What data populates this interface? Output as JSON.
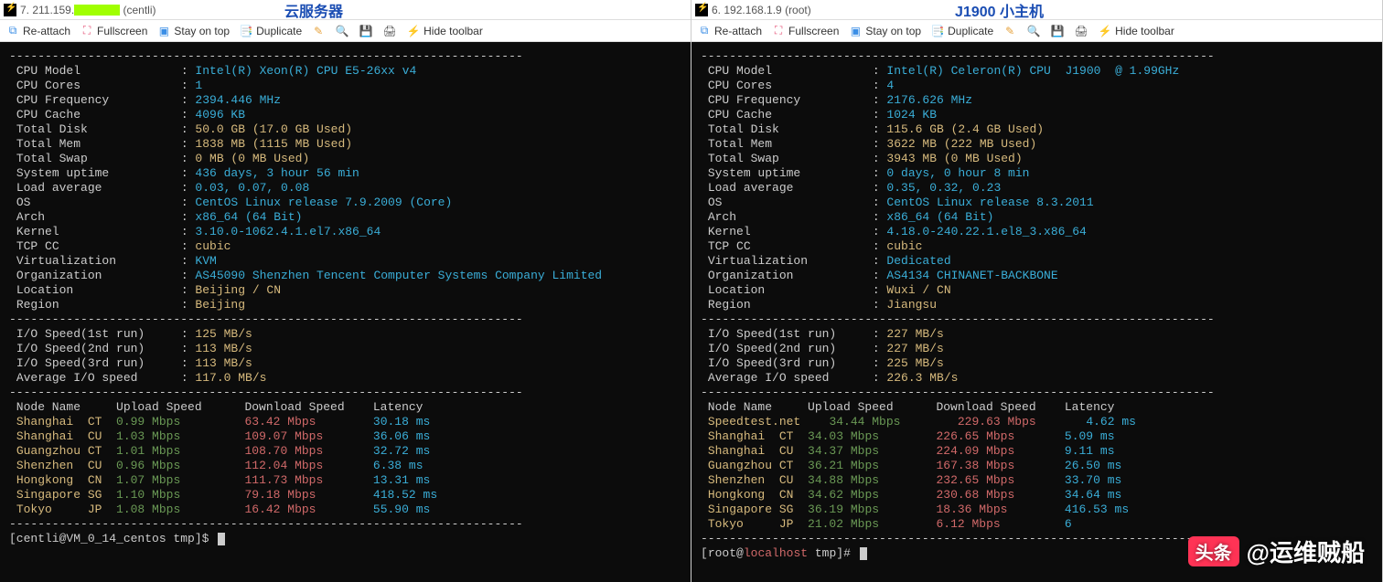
{
  "left": {
    "tab_title_prefix": "7. 211.159.",
    "tab_title_suffix": " (centli)",
    "header_label": "云服务器",
    "sysinfo": {
      "cpu_model": "Intel(R) Xeon(R) CPU E5-26xx v4",
      "cpu_cores": "1",
      "cpu_freq": "2394.446 MHz",
      "cpu_cache": "4096 KB",
      "total_disk": "50.0 GB (17.0 GB Used)",
      "total_mem": "1838 MB (1115 MB Used)",
      "total_swap": "0 MB (0 MB Used)",
      "uptime": "436 days, 3 hour 56 min",
      "load_avg": "0.03, 0.07, 0.08",
      "os": "CentOS Linux release 7.9.2009 (Core)",
      "arch": "x86_64 (64 Bit)",
      "kernel": "3.10.0-1062.4.1.el7.x86_64",
      "tcp_cc": "cubic",
      "virt": "KVM",
      "org": "AS45090 Shenzhen Tencent Computer Systems Company Limited",
      "location": "Beijing / CN",
      "region": "Beijing"
    },
    "io": {
      "r1": "125 MB/s",
      "r2": "113 MB/s",
      "r3": "113 MB/s",
      "avg": "117.0 MB/s"
    },
    "speed_headers": {
      "node": "Node Name",
      "up": "Upload Speed",
      "down": "Download Speed",
      "lat": "Latency"
    },
    "speeds": [
      {
        "name": "Shanghai",
        "tag": "CT",
        "up": "0.99 Mbps",
        "down": "63.42 Mbps",
        "lat": "30.18 ms"
      },
      {
        "name": "Shanghai",
        "tag": "CU",
        "up": "1.03 Mbps",
        "down": "109.07 Mbps",
        "lat": "36.06 ms"
      },
      {
        "name": "Guangzhou",
        "tag": "CT",
        "up": "1.01 Mbps",
        "down": "108.70 Mbps",
        "lat": "32.72 ms"
      },
      {
        "name": "Shenzhen",
        "tag": "CU",
        "up": "0.96 Mbps",
        "down": "112.04 Mbps",
        "lat": "6.38 ms"
      },
      {
        "name": "Hongkong",
        "tag": "CN",
        "up": "1.07 Mbps",
        "down": "111.73 Mbps",
        "lat": "13.31 ms"
      },
      {
        "name": "Singapore",
        "tag": "SG",
        "up": "1.10 Mbps",
        "down": "79.18 Mbps",
        "lat": "418.52 ms"
      },
      {
        "name": "Tokyo",
        "tag": "JP",
        "up": "1.08 Mbps",
        "down": "16.42 Mbps",
        "lat": "55.90 ms"
      }
    ],
    "prompt": {
      "user": "centli",
      "host": "VM_0_14_centos",
      "dir": "tmp",
      "symbol": "$"
    }
  },
  "right": {
    "tab_title": "6. 192.168.1.9 (root)",
    "header_label": "J1900 小主机",
    "sysinfo": {
      "cpu_model": "Intel(R) Celeron(R) CPU  J1900  @ 1.99GHz",
      "cpu_cores": "4",
      "cpu_freq": "2176.626 MHz",
      "cpu_cache": "1024 KB",
      "total_disk": "115.6 GB (2.4 GB Used)",
      "total_mem": "3622 MB (222 MB Used)",
      "total_swap": "3943 MB (0 MB Used)",
      "uptime": "0 days, 0 hour 8 min",
      "load_avg": "0.35, 0.32, 0.23",
      "os": "CentOS Linux release 8.3.2011",
      "arch": "x86_64 (64 Bit)",
      "kernel": "4.18.0-240.22.1.el8_3.x86_64",
      "tcp_cc": "cubic",
      "virt": "Dedicated",
      "org": "AS4134 CHINANET-BACKBONE",
      "location": "Wuxi / CN",
      "region": "Jiangsu"
    },
    "io": {
      "r1": "227 MB/s",
      "r2": "227 MB/s",
      "r3": "225 MB/s",
      "avg": "226.3 MB/s"
    },
    "speed_headers": {
      "node": "Node Name",
      "up": "Upload Speed",
      "down": "Download Speed",
      "lat": "Latency"
    },
    "speeds": [
      {
        "name": "Speedtest.net",
        "tag": "",
        "up": "34.44 Mbps",
        "down": "229.63 Mbps",
        "lat": "4.62 ms"
      },
      {
        "name": "Shanghai",
        "tag": "CT",
        "up": "34.03 Mbps",
        "down": "226.65 Mbps",
        "lat": "5.09 ms"
      },
      {
        "name": "Shanghai",
        "tag": "CU",
        "up": "34.37 Mbps",
        "down": "224.09 Mbps",
        "lat": "9.11 ms"
      },
      {
        "name": "Guangzhou",
        "tag": "CT",
        "up": "36.21 Mbps",
        "down": "167.38 Mbps",
        "lat": "26.50 ms"
      },
      {
        "name": "Shenzhen",
        "tag": "CU",
        "up": "34.88 Mbps",
        "down": "232.65 Mbps",
        "lat": "33.70 ms"
      },
      {
        "name": "Hongkong",
        "tag": "CN",
        "up": "34.62 Mbps",
        "down": "230.68 Mbps",
        "lat": "34.64 ms"
      },
      {
        "name": "Singapore",
        "tag": "SG",
        "up": "36.19 Mbps",
        "down": "18.36 Mbps",
        "lat": "416.53 ms"
      },
      {
        "name": "Tokyo",
        "tag": "JP",
        "up": "21.02 Mbps",
        "down": "6.12 Mbps",
        "lat": "6"
      }
    ],
    "prompt": {
      "user": "root",
      "host": "localhost",
      "dir": "tmp",
      "symbol": "#"
    }
  },
  "toolbar": {
    "reattach": "Re-attach",
    "fullscreen": "Fullscreen",
    "stayontop": "Stay on top",
    "duplicate": "Duplicate",
    "hide": "Hide toolbar"
  },
  "labels": {
    "cpu_model": "CPU Model",
    "cpu_cores": "CPU Cores",
    "cpu_freq": "CPU Frequency",
    "cpu_cache": "CPU Cache",
    "total_disk": "Total Disk",
    "total_mem": "Total Mem",
    "total_swap": "Total Swap",
    "uptime": "System uptime",
    "load_avg": "Load average",
    "os": "OS",
    "arch": "Arch",
    "kernel": "Kernel",
    "tcp_cc": "TCP CC",
    "virt": "Virtualization",
    "org": "Organization",
    "location": "Location",
    "region": "Region",
    "io1": "I/O Speed(1st run)",
    "io2": "I/O Speed(2nd run)",
    "io3": "I/O Speed(3rd run)",
    "ioavg": "Average I/O speed"
  },
  "watermark": {
    "badge": "头条",
    "text": "@运维贼船"
  }
}
